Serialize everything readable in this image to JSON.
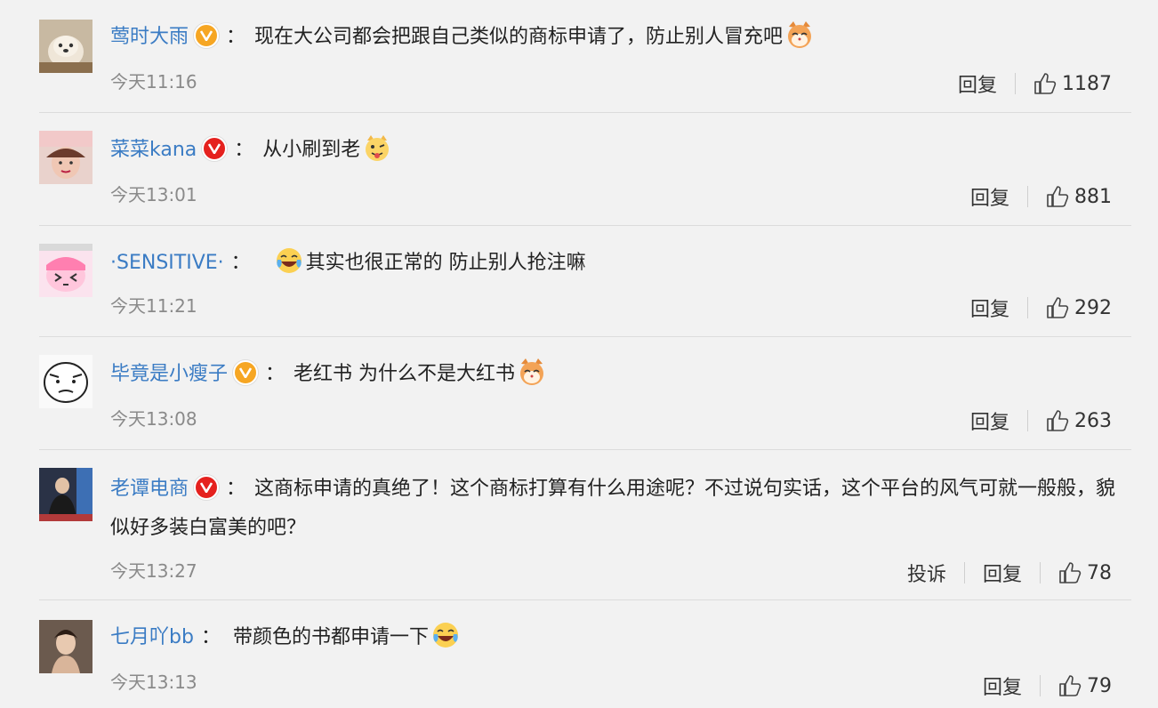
{
  "comments": [
    {
      "username": "莺时大雨",
      "badge": "gold",
      "colon": "：",
      "text": "现在大公司都会把跟自己类似的商标申请了，防止别人冒充吧",
      "emoji_after": "cat-face-icon",
      "time": "今天11:16",
      "report": "",
      "reply": "回复",
      "likes": "1187"
    },
    {
      "username": "菜菜kana",
      "badge": "red",
      "colon": "：",
      "text": "从小刷到老",
      "emoji_after": "tongue-face-icon",
      "time": "今天13:01",
      "report": "",
      "reply": "回复",
      "likes": "881"
    },
    {
      "username": "·SENSITIVE·",
      "badge": "",
      "colon": "：",
      "emoji_before": "laugh-cry-icon",
      "text": "其实也很正常的 防止别人抢注嘛",
      "time": "今天11:21",
      "report": "",
      "reply": "回复",
      "likes": "292"
    },
    {
      "username": "毕竟是小瘦子",
      "badge": "gold",
      "colon": "：",
      "text": "老红书 为什么不是大红书",
      "emoji_after": "cat-face-icon",
      "time": "今天13:08",
      "report": "",
      "reply": "回复",
      "likes": "263"
    },
    {
      "username": "老谭电商",
      "badge": "red",
      "colon": "：",
      "text": "这商标申请的真绝了！这个商标打算有什么用途呢？不过说句实话，这个平台的风气可就一般般，貌似好多装白富美的吧？",
      "time": "今天13:27",
      "report": "投诉",
      "reply": "回复",
      "likes": "78"
    },
    {
      "username": "七月吖bb",
      "badge": "",
      "colon": "：",
      "text": "带颜色的书都申请一下",
      "emoji_after": "laugh-cry-icon",
      "time": "今天13:13",
      "report": "",
      "reply": "回复",
      "likes": "79"
    }
  ],
  "colors": {
    "background": "#f2f2f2",
    "username": "#3b7cc4",
    "time": "#8a8a8a",
    "badge_gold": "#f6a623",
    "badge_red": "#e5211e"
  }
}
